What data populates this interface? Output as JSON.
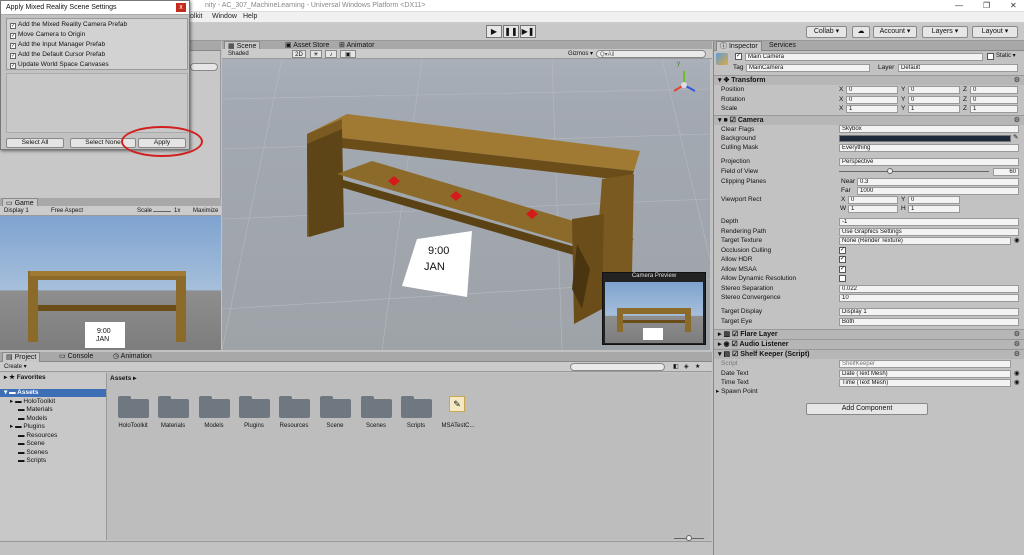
{
  "window": {
    "title": "Unity 5.6.1f1 Personal (64bit) - Main.unity - AC_307_MachineLearning - Universal Windows Platform <DX11>",
    "title_visible": "nity - AC_307_MachineLearning - Universal Windows Platform <DX11>",
    "min": "—",
    "max": "❐",
    "close": "✕"
  },
  "menubar": {
    "items": [
      "File",
      "Edit",
      "Assets",
      "GameObject",
      "Component",
      "HoloToolkit",
      "Window",
      "Help"
    ],
    "visible": [
      "olkit",
      "Window",
      "Help"
    ]
  },
  "toolbar": {
    "collab": "Collab ▾",
    "cloud": "☁",
    "account": "Account ▾",
    "layers": "Layers ▾",
    "layout": "Layout ▾",
    "play": "▶",
    "pause": "❚❚",
    "step": "▶❚"
  },
  "dialog": {
    "title": "Apply Mixed Reality Scene Settings",
    "close": "x",
    "options": [
      {
        "label": "Add the Mixed Reality Camera Prefab",
        "checked": true
      },
      {
        "label": "Move Camera to Origin",
        "checked": true
      },
      {
        "label": "Add the Input Manager Prefab",
        "checked": true
      },
      {
        "label": "Add the Default Cursor Prefab",
        "checked": true
      },
      {
        "label": "Update World Space Canvases",
        "checked": true
      }
    ],
    "select_all": "Select All",
    "select_none": "Select None",
    "apply": "Apply"
  },
  "scene": {
    "tabs": [
      "Scene",
      "Asset Store",
      "Animator"
    ],
    "shading": "Shaded",
    "mode_2d": "2D",
    "gizmos": "Gizmos ▾",
    "search": "Q▾All",
    "label_time": "9:00",
    "label_month": "JAN",
    "camera_preview": "Camera Preview",
    "gizmo_axis": "y"
  },
  "game": {
    "tab": "Game",
    "display": "Display 1",
    "aspect": "Free Aspect",
    "scale_label": "Scale",
    "scale_value": "1x",
    "maximize": "Maximize",
    "label_time": "9:00",
    "label_month": "JAN"
  },
  "project": {
    "tabs": [
      "Project",
      "Console",
      "Animation"
    ],
    "create": "Create ▾",
    "favorites": "Favorites",
    "assets_root": "Assets",
    "breadcrumb": "Assets ▸",
    "tree": [
      "HoloToolkit",
      "Materials",
      "Models",
      "Plugins",
      "Resources",
      "Scene",
      "Scenes",
      "Scripts"
    ],
    "folders": [
      "HoloToolkit",
      "Materials",
      "Models",
      "Plugins",
      "Resources",
      "Scene",
      "Scenes",
      "Scripts"
    ],
    "file": "MSATestC..."
  },
  "inspector": {
    "tabs": [
      "Inspector",
      "Services"
    ],
    "object_name": "Main Camera",
    "static": "Static ▾",
    "tag_label": "Tag",
    "tag": "MainCamera",
    "layer_label": "Layer",
    "layer": "Default",
    "transform": {
      "title": "Transform",
      "position": {
        "x": "0",
        "y": "0",
        "z": "0"
      },
      "rotation": {
        "x": "0",
        "y": "0",
        "z": "0"
      },
      "scale": {
        "x": "1",
        "y": "1",
        "z": "1"
      },
      "labels": [
        "Position",
        "Rotation",
        "Scale"
      ]
    },
    "camera": {
      "title": "Camera",
      "rows": [
        {
          "label": "Clear Flags",
          "value": "Skybox"
        },
        {
          "label": "Background",
          "value": ""
        },
        {
          "label": "Culling Mask",
          "value": "Everything"
        },
        {
          "label": "Projection",
          "value": "Perspective"
        },
        {
          "label": "Field of View",
          "value": "60"
        },
        {
          "label": "Clipping Planes",
          "near_label": "Near",
          "near": "0.3",
          "far_label": "Far",
          "far": "1000"
        },
        {
          "label": "Viewport Rect",
          "x": "0",
          "y": "0",
          "w": "1",
          "h": "1"
        },
        {
          "label": "Depth",
          "value": "-1"
        },
        {
          "label": "Rendering Path",
          "value": "Use Graphics Settings"
        },
        {
          "label": "Target Texture",
          "value": "None (Render Texture)"
        },
        {
          "label": "Occlusion Culling",
          "checked": true
        },
        {
          "label": "Allow HDR",
          "checked": true
        },
        {
          "label": "Allow MSAA",
          "checked": true
        },
        {
          "label": "Allow Dynamic Resolution",
          "checked": false
        },
        {
          "label": "Stereo Separation",
          "value": "0.022"
        },
        {
          "label": "Stereo Convergence",
          "value": "10"
        },
        {
          "label": "Target Display",
          "value": "Display 1"
        },
        {
          "label": "Target Eye",
          "value": "Both"
        }
      ]
    },
    "flare": "Flare Layer",
    "audio": "Audio Listener",
    "shelf": {
      "title": "Shelf Keeper (Script)",
      "script_label": "Script",
      "script": "ShelfKeeper",
      "date_label": "Date Text",
      "date": "Date (Text Mesh)",
      "time_label": "Time Text",
      "time": "Time (Text Mesh)",
      "spawn": "Spawn Point"
    },
    "add_component": "Add Component"
  },
  "colors": {
    "wood": "#8b6a2a",
    "wood_dark": "#5e4517",
    "accent_red": "#d21f1f",
    "gem": "#d61a1a"
  }
}
